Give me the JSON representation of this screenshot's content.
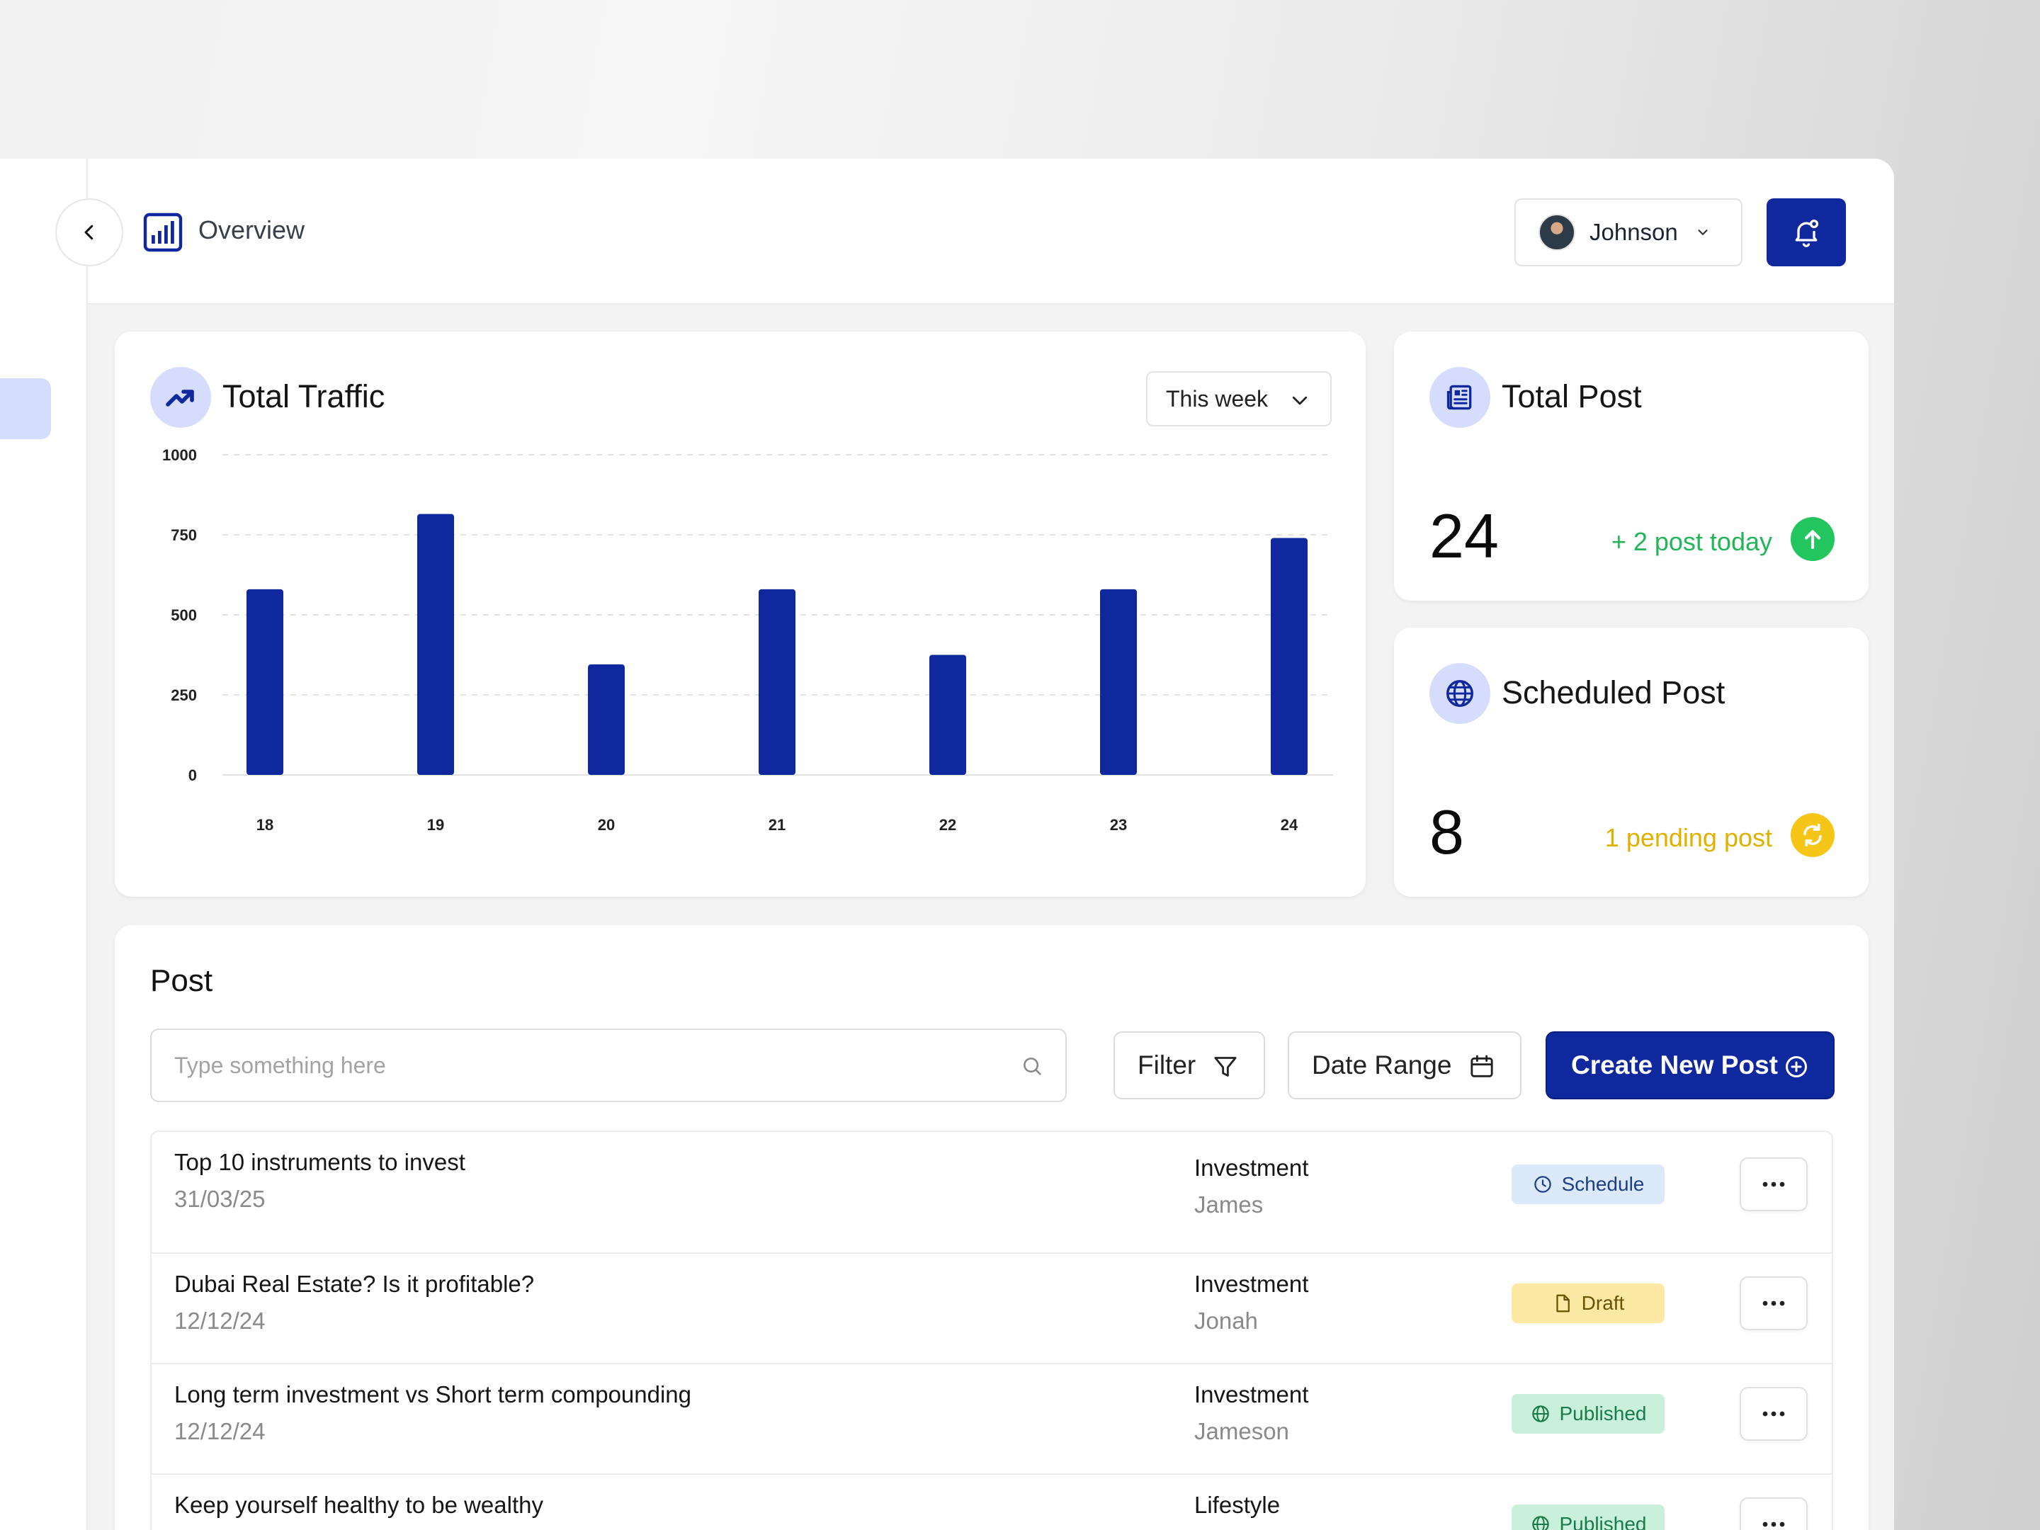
{
  "header": {
    "title": "Overview",
    "user_name": "Johnson"
  },
  "traffic": {
    "title": "Total Traffic",
    "range": "This week"
  },
  "total_post": {
    "title": "Total Post",
    "value": "24",
    "note": "+ 2 post today"
  },
  "scheduled_post": {
    "title": "Scheduled Post",
    "value": "8",
    "note": "1 pending post"
  },
  "post_list": {
    "title": "Post",
    "search_placeholder": "Type something here",
    "filter_label": "Filter",
    "date_range_label": "Date Range",
    "create_label": "Create New Post",
    "rows": [
      {
        "title": "Top 10 instruments to invest",
        "date": "31/03/25",
        "category": "Investment",
        "author": "James",
        "status": "Schedule"
      },
      {
        "title": "Dubai Real Estate? Is it profitable?",
        "date": "12/12/24",
        "category": "Investment",
        "author": "Jonah",
        "status": "Draft"
      },
      {
        "title": "Long term investment vs Short term compounding",
        "date": "12/12/24",
        "category": "Investment",
        "author": "Jameson",
        "status": "Published"
      },
      {
        "title": "Keep yourself healthy to be wealthy",
        "date": "",
        "category": "Lifestyle",
        "author": "",
        "status": "Published"
      }
    ]
  },
  "colors": {
    "primary": "#10289e",
    "success": "#22c55e",
    "warning": "#eab308",
    "icon_bg": "#d6dcfb"
  },
  "chart_data": {
    "type": "bar",
    "categories": [
      "18",
      "19",
      "20",
      "21",
      "22",
      "23",
      "24"
    ],
    "values": [
      580,
      815,
      345,
      580,
      375,
      580,
      740
    ],
    "yticks": [
      "0",
      "250",
      "500",
      "750",
      "1000"
    ],
    "ylim": [
      0,
      1000
    ],
    "grid": true,
    "color": "#10289e"
  }
}
